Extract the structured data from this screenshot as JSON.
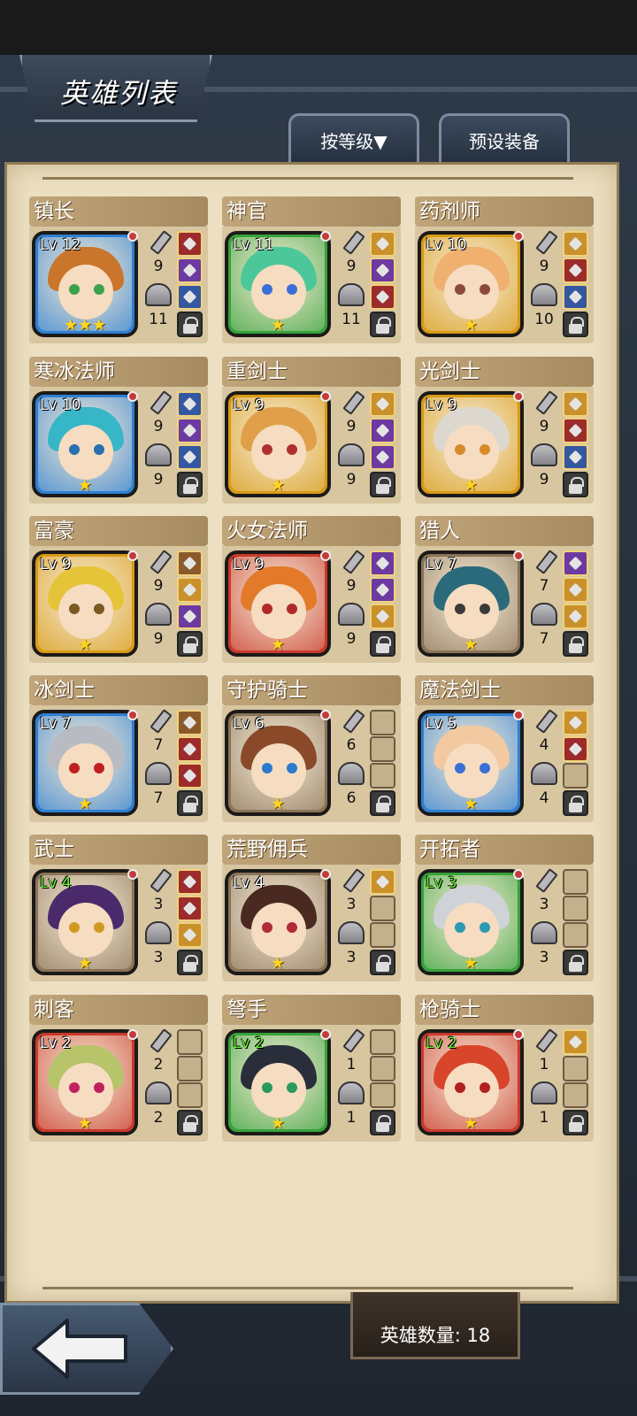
{
  "header": {
    "title": "英雄列表"
  },
  "toolbar": {
    "sort_label": "按等级▼",
    "preset_label": "预设装备"
  },
  "footer": {
    "hero_count": "英雄数量: 18"
  },
  "heroes": [
    {
      "name": "镇长",
      "level": "Lv 12",
      "level_green": false,
      "stars": "★★★",
      "attack": "9",
      "defense": "11",
      "frame": "#2e7fd1",
      "slots": [
        "red",
        "filled",
        "blue"
      ],
      "hair": "#c9752b",
      "eyes": "#3aa34a"
    },
    {
      "name": "神官",
      "level": "Lv 11",
      "level_green": false,
      "stars": "★",
      "attack": "9",
      "defense": "11",
      "frame": "#36a23a",
      "slots": [
        "gold",
        "filled",
        "red"
      ],
      "hair": "#4cc79a",
      "eyes": "#3a6fd6"
    },
    {
      "name": "药剂师",
      "level": "Lv 10",
      "level_green": false,
      "stars": "★",
      "attack": "9",
      "defense": "10",
      "frame": "#d89a16",
      "slots": [
        "gold",
        "red",
        "blue"
      ],
      "hair": "#f0b070",
      "eyes": "#8a4a3a"
    },
    {
      "name": "寒冰法师",
      "level": "Lv 10",
      "level_green": false,
      "stars": "★",
      "attack": "9",
      "defense": "9",
      "frame": "#2e7fd1",
      "slots": [
        "blue",
        "filled",
        "blue"
      ],
      "hair": "#36b6c6",
      "eyes": "#2a6fb0"
    },
    {
      "name": "重剑士",
      "level": "Lv 9",
      "level_green": false,
      "stars": "★",
      "attack": "9",
      "defense": "9",
      "frame": "#d89a16",
      "slots": [
        "gold",
        "filled",
        "filled"
      ],
      "hair": "#e0a04a",
      "eyes": "#b03030"
    },
    {
      "name": "光剑士",
      "level": "Lv 9",
      "level_green": false,
      "stars": "★",
      "attack": "9",
      "defense": "9",
      "frame": "#d89a16",
      "slots": [
        "gold",
        "red",
        "blue"
      ],
      "hair": "#ddd8cf",
      "eyes": "#d88a2a"
    },
    {
      "name": "富豪",
      "level": "Lv 9",
      "level_green": false,
      "stars": "★",
      "attack": "9",
      "defense": "9",
      "frame": "#d89a16",
      "slots": [
        "brown",
        "gold",
        "filled"
      ],
      "hair": "#e6c43a",
      "eyes": "#7a5a20"
    },
    {
      "name": "火女法师",
      "level": "Lv 9",
      "level_green": false,
      "stars": "★",
      "attack": "9",
      "defense": "9",
      "frame": "#c9392b",
      "slots": [
        "filled",
        "filled",
        "gold"
      ],
      "hair": "#e27a2a",
      "eyes": "#b02a2a"
    },
    {
      "name": "猎人",
      "level": "Lv 7",
      "level_green": false,
      "stars": "★",
      "attack": "7",
      "defense": "7",
      "frame": "#8a7356",
      "slots": [
        "filled",
        "gold",
        "gold"
      ],
      "hair": "#2a6a7a",
      "eyes": "#3a3a3a"
    },
    {
      "name": "冰剑士",
      "level": "Lv 7",
      "level_green": false,
      "stars": "★",
      "attack": "7",
      "defense": "7",
      "frame": "#2e7fd1",
      "slots": [
        "brown",
        "red",
        "red"
      ],
      "hair": "#b8bcc2",
      "eyes": "#c02020"
    },
    {
      "name": "守护骑士",
      "level": "Lv 6",
      "level_green": false,
      "stars": "★",
      "attack": "6",
      "defense": "6",
      "frame": "#8a7356",
      "slots": [
        "",
        "",
        ""
      ],
      "hair": "#8a4a2a",
      "eyes": "#2a7ad0"
    },
    {
      "name": "魔法剑士",
      "level": "Lv 5",
      "level_green": false,
      "stars": "★",
      "attack": "4",
      "defense": "4",
      "frame": "#2e7fd1",
      "slots": [
        "gold",
        "red",
        ""
      ],
      "hair": "#f2c9a0",
      "eyes": "#3a6fd6"
    },
    {
      "name": "武士",
      "level": "Lv 4",
      "level_green": true,
      "stars": "★",
      "attack": "3",
      "defense": "3",
      "frame": "#8a7356",
      "slots": [
        "red",
        "red",
        "gold"
      ],
      "hair": "#4a2a6a",
      "eyes": "#d09a20"
    },
    {
      "name": "荒野佣兵",
      "level": "Lv 4",
      "level_green": false,
      "stars": "★",
      "attack": "3",
      "defense": "3",
      "frame": "#8a7356",
      "slots": [
        "gold",
        "",
        ""
      ],
      "hair": "#4a2a20",
      "eyes": "#b02a3a"
    },
    {
      "name": "开拓者",
      "level": "Lv 3",
      "level_green": true,
      "stars": "★",
      "attack": "3",
      "defense": "3",
      "frame": "#36a23a",
      "slots": [
        "",
        "",
        ""
      ],
      "hair": "#cfd3d8",
      "eyes": "#2a9ab0"
    },
    {
      "name": "刺客",
      "level": "Lv 2",
      "level_green": false,
      "stars": "★",
      "attack": "2",
      "defense": "2",
      "frame": "#c9392b",
      "slots": [
        "",
        "",
        ""
      ],
      "hair": "#b7c46a",
      "eyes": "#c02060"
    },
    {
      "name": "弩手",
      "level": "Lv 2",
      "level_green": true,
      "stars": "★",
      "attack": "1",
      "defense": "1",
      "frame": "#36a23a",
      "slots": [
        "",
        "",
        ""
      ],
      "hair": "#2a2e3a",
      "eyes": "#2a9a5a"
    },
    {
      "name": "枪骑士",
      "level": "Lv 2",
      "level_green": true,
      "stars": "★",
      "attack": "1",
      "defense": "1",
      "frame": "#c9392b",
      "slots": [
        "gold",
        "",
        ""
      ],
      "hair": "#d8452a",
      "eyes": "#b02020"
    }
  ]
}
